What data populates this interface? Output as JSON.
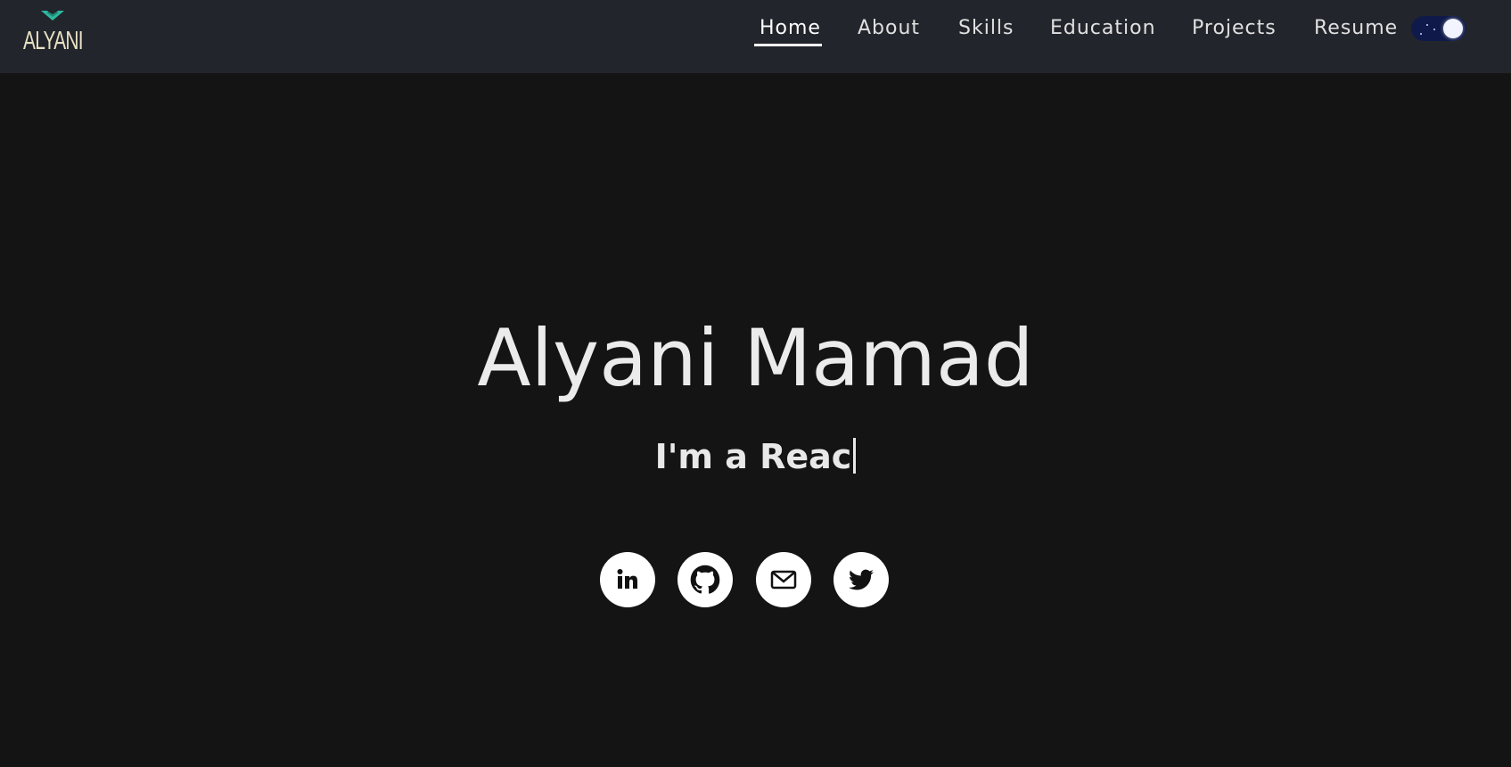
{
  "brand": {
    "logo_text": "ALYANI",
    "logo_color": "#e8e2c4",
    "wing_color": "#2fb8a0"
  },
  "nav": {
    "items": [
      {
        "label": "Home",
        "active": true
      },
      {
        "label": "About",
        "active": false
      },
      {
        "label": "Skills",
        "active": false
      },
      {
        "label": "Education",
        "active": false
      },
      {
        "label": "Projects",
        "active": false
      },
      {
        "label": "Resume",
        "active": false
      }
    ],
    "theme_toggle": {
      "icon": "moon-stars-icon",
      "state": "dark"
    }
  },
  "hero": {
    "name": "Alyani Mamad",
    "typed_text": "I'm a Reac"
  },
  "socials": [
    {
      "icon": "linkedin-icon"
    },
    {
      "icon": "github-icon"
    },
    {
      "icon": "mail-icon"
    },
    {
      "icon": "twitter-icon"
    }
  ],
  "colors": {
    "page_background": "#141414",
    "navbar_background": "#22252b",
    "text": "#ebebeb",
    "toggle_background": "#0f1a4a"
  }
}
